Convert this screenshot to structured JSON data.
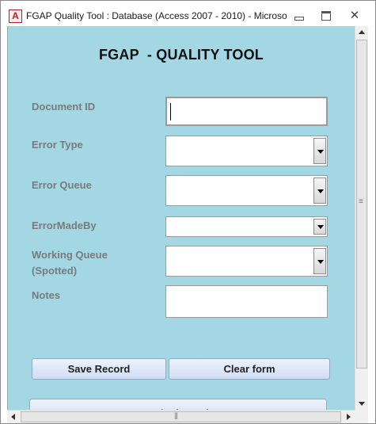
{
  "window": {
    "app_icon_letter": "A",
    "title": "FGAP Quality Tool : Database (Access 2007 - 2010) - Microso...",
    "minimize_icon": "minimize-icon",
    "maximize_icon": "maximize-icon",
    "close_glyph": "✕"
  },
  "form": {
    "title": "FGAP  - QUALITY TOOL",
    "background_color": "#a3d7e3",
    "fields": {
      "document_id": {
        "label": "Document ID",
        "value": ""
      },
      "error_type": {
        "label": "Error Type",
        "value": ""
      },
      "error_queue": {
        "label": "Error Queue",
        "value": ""
      },
      "error_made_by": {
        "label": "ErrorMadeBy",
        "value": ""
      },
      "working_queue": {
        "label_line1": "Working Queue",
        "label_line2": "(Spotted)",
        "value": ""
      },
      "notes": {
        "label": "Notes",
        "value": ""
      }
    },
    "buttons": {
      "save": "Save Record",
      "clear": "Clear form",
      "submit_partial": "Submit Total"
    }
  }
}
